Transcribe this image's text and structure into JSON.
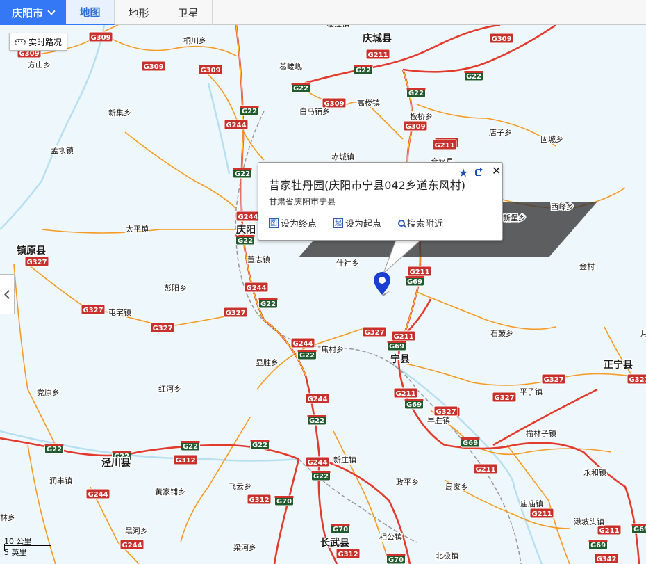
{
  "topbar": {
    "city": "庆阳市",
    "tabs": [
      "地图",
      "地形",
      "卫星"
    ],
    "active_tab": "地图"
  },
  "controls": {
    "traffic_label": "实时路况",
    "traffic_icon": "••••"
  },
  "popup": {
    "title": "昔家牡丹园(庆阳市宁县042乡道东风村)",
    "address": "甘肃省庆阳市宁县",
    "actions": [
      {
        "icon": "图",
        "label": "设为终点"
      },
      {
        "icon": "起",
        "label": "设为起点"
      },
      {
        "label": "搜索附近"
      }
    ],
    "star": "★",
    "close": "✕"
  },
  "scale": {
    "metric": "10 公里",
    "imperial": "5 英里"
  },
  "colors": {
    "accent": "#3478f6",
    "major_road": "#e23b2e",
    "minor_road": "#f59a23",
    "water": "#b6dff2",
    "marker": "#1a3fd1"
  },
  "places": [
    {
      "name": "庆城县",
      "major": true
    },
    {
      "name": "庆阳",
      "major": true
    },
    {
      "name": "镇原县",
      "major": true
    },
    {
      "name": "宁县",
      "major": true
    },
    {
      "name": "正宁县",
      "major": true
    },
    {
      "name": "泾川县",
      "major": true
    },
    {
      "name": "长武县",
      "major": true
    },
    {
      "name": "方山乡"
    },
    {
      "name": "桐川乡"
    },
    {
      "name": "葛崾岘"
    },
    {
      "name": "白马铺乡"
    },
    {
      "name": "高楼镇"
    },
    {
      "name": "板桥乡"
    },
    {
      "name": "店子乡"
    },
    {
      "name": "固城乡"
    },
    {
      "name": "新集乡"
    },
    {
      "name": "孟坝镇"
    },
    {
      "name": "赤城镇"
    },
    {
      "name": "合水县"
    },
    {
      "name": "太平镇"
    },
    {
      "name": "董志镇"
    },
    {
      "name": "什社乡"
    },
    {
      "name": "彭阳乡"
    },
    {
      "name": "屯字镇"
    },
    {
      "name": "焦村乡"
    },
    {
      "name": "显胜乡"
    },
    {
      "name": "红河乡"
    },
    {
      "name": "党原乡"
    },
    {
      "name": "石鼓乡"
    },
    {
      "name": "金村"
    },
    {
      "name": "平子镇"
    },
    {
      "name": "早胜镇"
    },
    {
      "name": "榆林子镇"
    },
    {
      "name": "永和镇"
    },
    {
      "name": "新庄镇"
    },
    {
      "name": "政平乡"
    },
    {
      "name": "周家乡"
    },
    {
      "name": "庙庙镇"
    },
    {
      "name": "湫坡头镇"
    },
    {
      "name": "润丰镇"
    },
    {
      "name": "黄家铺乡"
    },
    {
      "name": "飞云乡"
    },
    {
      "name": "黑河乡"
    },
    {
      "name": "梁河乡"
    },
    {
      "name": "相公镇"
    },
    {
      "name": "北极镇"
    },
    {
      "name": "林乡"
    },
    {
      "name": "西峰乡"
    },
    {
      "name": "新堡乡"
    },
    {
      "name": "月"
    },
    {
      "name": "临泾镇"
    }
  ],
  "shields": [
    {
      "label": "G309",
      "type": "g"
    },
    {
      "label": "G309",
      "type": "g"
    },
    {
      "label": "G309",
      "type": "g"
    },
    {
      "label": "G309",
      "type": "g"
    },
    {
      "label": "G309",
      "type": "g"
    },
    {
      "label": "G309",
      "type": "g"
    },
    {
      "label": "G309",
      "type": "g"
    },
    {
      "label": "G211",
      "type": "g"
    },
    {
      "label": "G211",
      "type": "g"
    },
    {
      "label": "G211",
      "type": "g"
    },
    {
      "label": "G211",
      "type": "g"
    },
    {
      "label": "G211",
      "type": "g"
    },
    {
      "label": "G211",
      "type": "g"
    },
    {
      "label": "G211",
      "type": "g"
    },
    {
      "label": "G211",
      "type": "g"
    },
    {
      "label": "G211",
      "type": "g"
    },
    {
      "label": "G22",
      "type": "e"
    },
    {
      "label": "G22",
      "type": "e"
    },
    {
      "label": "G22",
      "type": "e"
    },
    {
      "label": "G22",
      "type": "e"
    },
    {
      "label": "G22",
      "type": "e"
    },
    {
      "label": "G22",
      "type": "e"
    },
    {
      "label": "G22",
      "type": "e"
    },
    {
      "label": "G22",
      "type": "e"
    },
    {
      "label": "G22",
      "type": "e"
    },
    {
      "label": "G22",
      "type": "e"
    },
    {
      "label": "G22",
      "type": "e"
    },
    {
      "label": "G22",
      "type": "e"
    },
    {
      "label": "G22",
      "type": "e"
    },
    {
      "label": "G22",
      "type": "e"
    },
    {
      "label": "G22",
      "type": "e"
    },
    {
      "label": "G244",
      "type": "g"
    },
    {
      "label": "G244",
      "type": "g"
    },
    {
      "label": "G244",
      "type": "g"
    },
    {
      "label": "G244",
      "type": "g"
    },
    {
      "label": "G244",
      "type": "g"
    },
    {
      "label": "G244",
      "type": "g"
    },
    {
      "label": "G244",
      "type": "g"
    },
    {
      "label": "G244",
      "type": "g"
    },
    {
      "label": "G244",
      "type": "g"
    },
    {
      "label": "G327",
      "type": "g"
    },
    {
      "label": "G327",
      "type": "g"
    },
    {
      "label": "G327",
      "type": "g"
    },
    {
      "label": "G327",
      "type": "g"
    },
    {
      "label": "G327",
      "type": "g"
    },
    {
      "label": "G327",
      "type": "g"
    },
    {
      "label": "G327",
      "type": "g"
    },
    {
      "label": "G327",
      "type": "g"
    },
    {
      "label": "G327",
      "type": "g"
    },
    {
      "label": "G69",
      "type": "e"
    },
    {
      "label": "G69",
      "type": "e"
    },
    {
      "label": "G69",
      "type": "e"
    },
    {
      "label": "G69",
      "type": "e"
    },
    {
      "label": "G69",
      "type": "e"
    },
    {
      "label": "G69",
      "type": "e"
    },
    {
      "label": "G312",
      "type": "g"
    },
    {
      "label": "G312",
      "type": "g"
    },
    {
      "label": "G312",
      "type": "g"
    },
    {
      "label": "G70",
      "type": "e"
    },
    {
      "label": "G70",
      "type": "e"
    },
    {
      "label": "G70",
      "type": "e"
    },
    {
      "label": "G342",
      "type": "g"
    }
  ]
}
